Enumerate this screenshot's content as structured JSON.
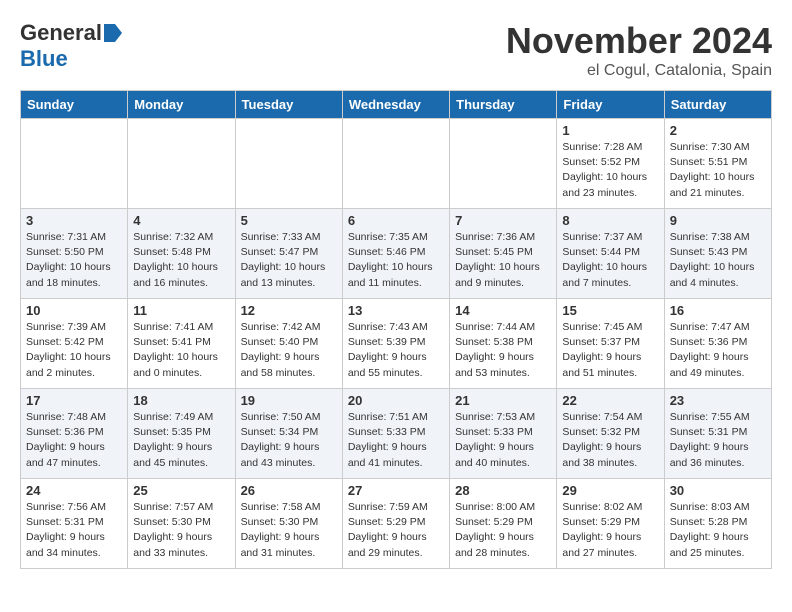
{
  "header": {
    "logo_line1": "General",
    "logo_line2": "Blue",
    "month": "November 2024",
    "location": "el Cogul, Catalonia, Spain"
  },
  "weekdays": [
    "Sunday",
    "Monday",
    "Tuesday",
    "Wednesday",
    "Thursday",
    "Friday",
    "Saturday"
  ],
  "weeks": [
    [
      {
        "day": "",
        "info": ""
      },
      {
        "day": "",
        "info": ""
      },
      {
        "day": "",
        "info": ""
      },
      {
        "day": "",
        "info": ""
      },
      {
        "day": "",
        "info": ""
      },
      {
        "day": "1",
        "info": "Sunrise: 7:28 AM\nSunset: 5:52 PM\nDaylight: 10 hours\nand 23 minutes."
      },
      {
        "day": "2",
        "info": "Sunrise: 7:30 AM\nSunset: 5:51 PM\nDaylight: 10 hours\nand 21 minutes."
      }
    ],
    [
      {
        "day": "3",
        "info": "Sunrise: 7:31 AM\nSunset: 5:50 PM\nDaylight: 10 hours\nand 18 minutes."
      },
      {
        "day": "4",
        "info": "Sunrise: 7:32 AM\nSunset: 5:48 PM\nDaylight: 10 hours\nand 16 minutes."
      },
      {
        "day": "5",
        "info": "Sunrise: 7:33 AM\nSunset: 5:47 PM\nDaylight: 10 hours\nand 13 minutes."
      },
      {
        "day": "6",
        "info": "Sunrise: 7:35 AM\nSunset: 5:46 PM\nDaylight: 10 hours\nand 11 minutes."
      },
      {
        "day": "7",
        "info": "Sunrise: 7:36 AM\nSunset: 5:45 PM\nDaylight: 10 hours\nand 9 minutes."
      },
      {
        "day": "8",
        "info": "Sunrise: 7:37 AM\nSunset: 5:44 PM\nDaylight: 10 hours\nand 7 minutes."
      },
      {
        "day": "9",
        "info": "Sunrise: 7:38 AM\nSunset: 5:43 PM\nDaylight: 10 hours\nand 4 minutes."
      }
    ],
    [
      {
        "day": "10",
        "info": "Sunrise: 7:39 AM\nSunset: 5:42 PM\nDaylight: 10 hours\nand 2 minutes."
      },
      {
        "day": "11",
        "info": "Sunrise: 7:41 AM\nSunset: 5:41 PM\nDaylight: 10 hours\nand 0 minutes."
      },
      {
        "day": "12",
        "info": "Sunrise: 7:42 AM\nSunset: 5:40 PM\nDaylight: 9 hours\nand 58 minutes."
      },
      {
        "day": "13",
        "info": "Sunrise: 7:43 AM\nSunset: 5:39 PM\nDaylight: 9 hours\nand 55 minutes."
      },
      {
        "day": "14",
        "info": "Sunrise: 7:44 AM\nSunset: 5:38 PM\nDaylight: 9 hours\nand 53 minutes."
      },
      {
        "day": "15",
        "info": "Sunrise: 7:45 AM\nSunset: 5:37 PM\nDaylight: 9 hours\nand 51 minutes."
      },
      {
        "day": "16",
        "info": "Sunrise: 7:47 AM\nSunset: 5:36 PM\nDaylight: 9 hours\nand 49 minutes."
      }
    ],
    [
      {
        "day": "17",
        "info": "Sunrise: 7:48 AM\nSunset: 5:36 PM\nDaylight: 9 hours\nand 47 minutes."
      },
      {
        "day": "18",
        "info": "Sunrise: 7:49 AM\nSunset: 5:35 PM\nDaylight: 9 hours\nand 45 minutes."
      },
      {
        "day": "19",
        "info": "Sunrise: 7:50 AM\nSunset: 5:34 PM\nDaylight: 9 hours\nand 43 minutes."
      },
      {
        "day": "20",
        "info": "Sunrise: 7:51 AM\nSunset: 5:33 PM\nDaylight: 9 hours\nand 41 minutes."
      },
      {
        "day": "21",
        "info": "Sunrise: 7:53 AM\nSunset: 5:33 PM\nDaylight: 9 hours\nand 40 minutes."
      },
      {
        "day": "22",
        "info": "Sunrise: 7:54 AM\nSunset: 5:32 PM\nDaylight: 9 hours\nand 38 minutes."
      },
      {
        "day": "23",
        "info": "Sunrise: 7:55 AM\nSunset: 5:31 PM\nDaylight: 9 hours\nand 36 minutes."
      }
    ],
    [
      {
        "day": "24",
        "info": "Sunrise: 7:56 AM\nSunset: 5:31 PM\nDaylight: 9 hours\nand 34 minutes."
      },
      {
        "day": "25",
        "info": "Sunrise: 7:57 AM\nSunset: 5:30 PM\nDaylight: 9 hours\nand 33 minutes."
      },
      {
        "day": "26",
        "info": "Sunrise: 7:58 AM\nSunset: 5:30 PM\nDaylight: 9 hours\nand 31 minutes."
      },
      {
        "day": "27",
        "info": "Sunrise: 7:59 AM\nSunset: 5:29 PM\nDaylight: 9 hours\nand 29 minutes."
      },
      {
        "day": "28",
        "info": "Sunrise: 8:00 AM\nSunset: 5:29 PM\nDaylight: 9 hours\nand 28 minutes."
      },
      {
        "day": "29",
        "info": "Sunrise: 8:02 AM\nSunset: 5:29 PM\nDaylight: 9 hours\nand 27 minutes."
      },
      {
        "day": "30",
        "info": "Sunrise: 8:03 AM\nSunset: 5:28 PM\nDaylight: 9 hours\nand 25 minutes."
      }
    ]
  ]
}
